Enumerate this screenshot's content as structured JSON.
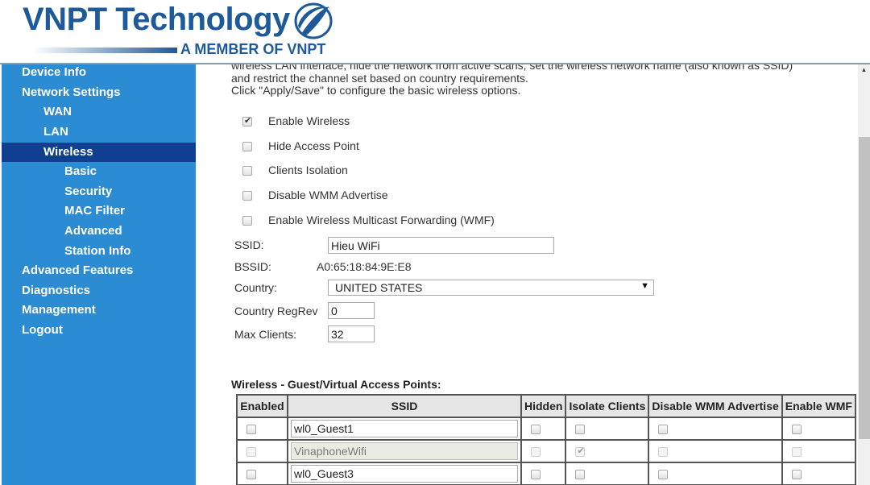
{
  "header": {
    "brand": "VNPT Technology",
    "tagline": "A MEMBER OF VNPT",
    "logo_icon": "vnpt-swoosh-icon",
    "colors": {
      "brand": "#1e5a9a",
      "sidebar": "#2b8bd3",
      "sidebar_active": "#0f3f8e"
    }
  },
  "sidebar": {
    "items": [
      {
        "label": "Device Info",
        "level": 0
      },
      {
        "label": "Network Settings",
        "level": 0
      },
      {
        "label": "WAN",
        "level": 1
      },
      {
        "label": "LAN",
        "level": 1
      },
      {
        "label": "Wireless",
        "level": 1,
        "active": true
      },
      {
        "label": "Basic",
        "level": 2
      },
      {
        "label": "Security",
        "level": 2
      },
      {
        "label": "MAC Filter",
        "level": 2
      },
      {
        "label": "Advanced",
        "level": 2
      },
      {
        "label": "Station Info",
        "level": 2
      },
      {
        "label": "Advanced Features",
        "level": 0
      },
      {
        "label": "Diagnostics",
        "level": 0
      },
      {
        "label": "Management",
        "level": 0
      },
      {
        "label": "Logout",
        "level": 0
      }
    ]
  },
  "intro": {
    "line1": "wireless LAN interface, hide the network from active scans, set the wireless network name (also known as SSID)",
    "line2": "and restrict the channel set based on country requirements.",
    "line3": "Click \"Apply/Save\" to configure the basic wireless options."
  },
  "options": [
    {
      "label": "Enable Wireless",
      "checked": true
    },
    {
      "label": "Hide Access Point",
      "checked": false
    },
    {
      "label": "Clients Isolation",
      "checked": false
    },
    {
      "label": "Disable WMM Advertise",
      "checked": false
    },
    {
      "label": "Enable Wireless Multicast Forwarding (WMF)",
      "checked": false
    }
  ],
  "fields": {
    "ssid_label": "SSID:",
    "ssid_value": "Hieu WiFi",
    "bssid_label": "BSSID:",
    "bssid_value": "A0:65:18:84:9E:E8",
    "country_label": "Country:",
    "country_value": "UNITED STATES",
    "regrev_label": "Country RegRev",
    "regrev_value": "0",
    "maxclients_label": "Max Clients:",
    "maxclients_value": "32"
  },
  "guest": {
    "title": "Wireless - Guest/Virtual Access Points:",
    "headers": [
      "Enabled",
      "SSID",
      "Hidden",
      "Isolate Clients",
      "Disable WMM Advertise",
      "Enable WMF"
    ],
    "rows": [
      {
        "enabled": false,
        "ssid": "wl0_Guest1",
        "hidden": false,
        "isolate": false,
        "disable_wmm": false,
        "wmf": false,
        "disabled": false
      },
      {
        "enabled": false,
        "ssid": "VinaphoneWifi",
        "hidden": false,
        "isolate": true,
        "disable_wmm": false,
        "wmf": false,
        "disabled": true
      },
      {
        "enabled": false,
        "ssid": "wl0_Guest3",
        "hidden": false,
        "isolate": false,
        "disable_wmm": false,
        "wmf": false,
        "disabled": false
      }
    ]
  }
}
